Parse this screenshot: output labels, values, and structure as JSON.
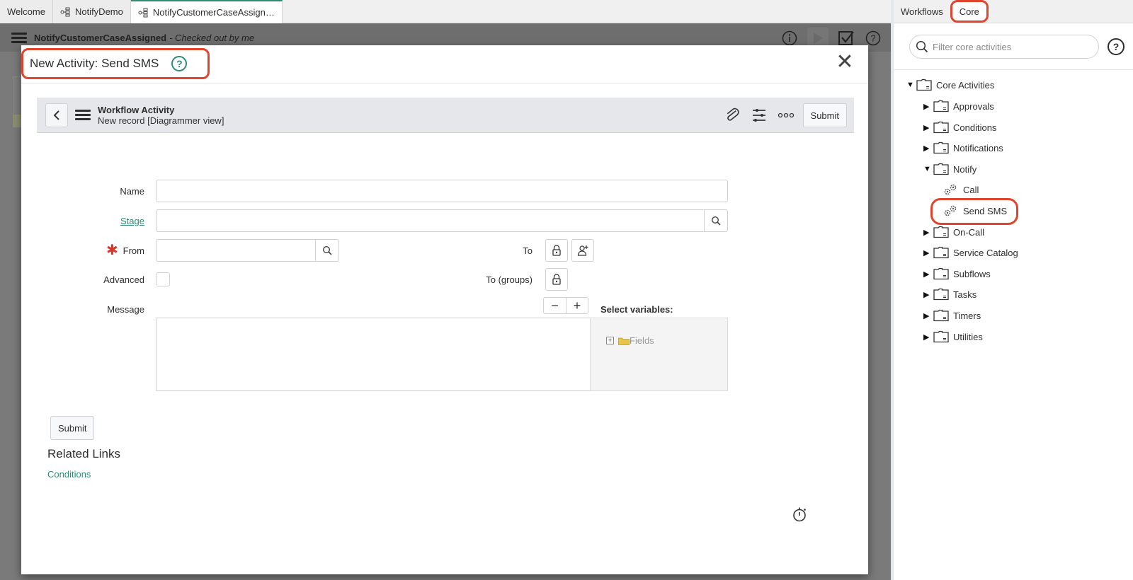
{
  "tabs": [
    {
      "label": "Welcome",
      "icon": null,
      "active": false
    },
    {
      "label": "NotifyDemo",
      "icon": "workflow-icon",
      "active": false
    },
    {
      "label": "NotifyCustomerCaseAssign…",
      "icon": "workflow-icon",
      "active": true
    }
  ],
  "workflow_bar": {
    "name": "NotifyCustomerCaseAssigned",
    "status": "- Checked out by me",
    "icons": [
      "info-icon",
      "play-icon",
      "checkbox-icon",
      "help-icon"
    ]
  },
  "modal": {
    "title": "New Activity: Send SMS",
    "help_icon": "help-icon",
    "close_icon": "close-icon",
    "form_header": {
      "title": "Workflow Activity",
      "subtitle": "New record [Diagrammer view]",
      "back_icon": "chevron-left-icon",
      "menu_icon": "hamburger-icon",
      "right_icons": [
        "paperclip-icon",
        "sliders-icon",
        "more-icon"
      ],
      "submit_label": "Submit"
    },
    "fields": {
      "name": {
        "label": "Name",
        "value": ""
      },
      "stage": {
        "label": "Stage",
        "value": ""
      },
      "from": {
        "label": "From",
        "value": "",
        "required": true
      },
      "advanced": {
        "label": "Advanced",
        "checked": false
      },
      "message": {
        "label": "Message",
        "value": ""
      },
      "to": {
        "label": "To"
      },
      "to_groups": {
        "label": "To (groups)"
      },
      "select_variables": {
        "label": "Select variables:",
        "tree_item": "Fields"
      }
    },
    "pm_buttons": {
      "minus": "−",
      "plus": "+"
    },
    "submit_label": "Submit",
    "related_links": {
      "title": "Related Links",
      "links": [
        "Conditions"
      ]
    }
  },
  "right_panel": {
    "tabs": [
      {
        "label": "Workflows",
        "active": false
      },
      {
        "label": "Core",
        "active": true
      }
    ],
    "search_placeholder": "Filter core activities",
    "tree": {
      "root": "Core Activities",
      "items": [
        {
          "label": "Approvals",
          "expanded": false
        },
        {
          "label": "Conditions",
          "expanded": false
        },
        {
          "label": "Notifications",
          "expanded": false
        },
        {
          "label": "Notify",
          "expanded": true,
          "children": [
            "Call",
            "Send SMS"
          ]
        },
        {
          "label": "On-Call",
          "expanded": false
        },
        {
          "label": "Service Catalog",
          "expanded": false
        },
        {
          "label": "Subflows",
          "expanded": false
        },
        {
          "label": "Tasks",
          "expanded": false
        },
        {
          "label": "Timers",
          "expanded": false
        },
        {
          "label": "Utilities",
          "expanded": false
        }
      ]
    }
  },
  "colors": {
    "accent": "#2e8b75",
    "highlight": "#e0442c",
    "required": "#d8372a",
    "overlay": "#7a7a7a"
  }
}
